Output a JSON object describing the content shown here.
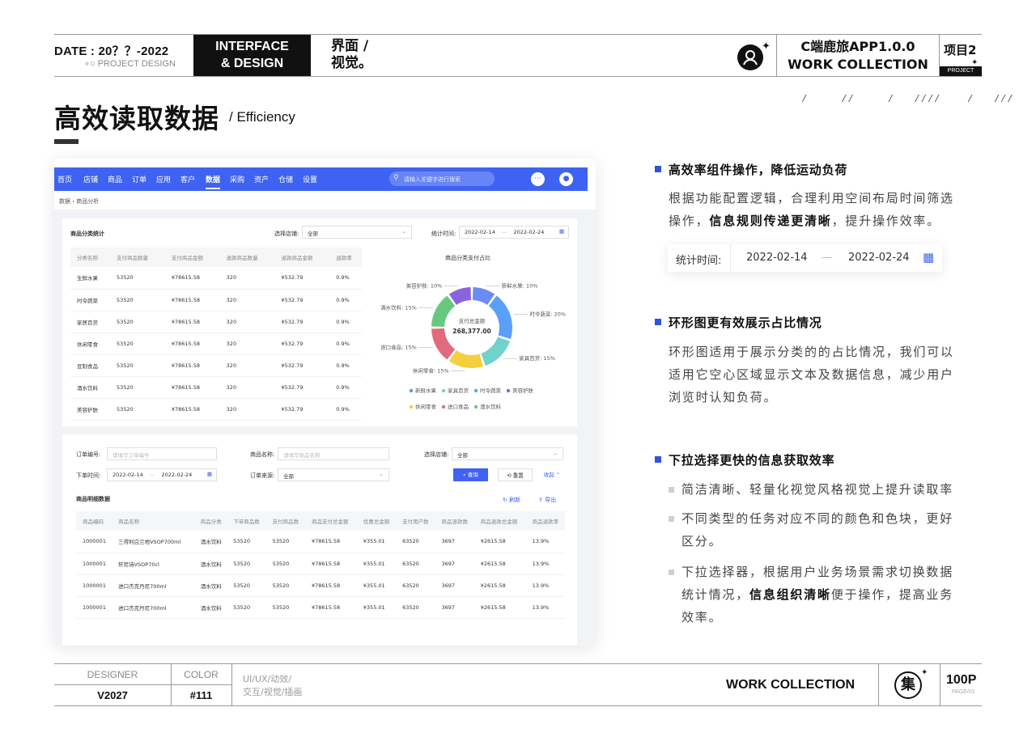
{
  "header": {
    "date": "DATE : 20？？-2022",
    "project_design": "∘○ PROJECT DESIGN",
    "interface_line1": "INTERFACE",
    "interface_line2": "& DESIGN",
    "cn_line1": "界面 /",
    "cn_line2": "视觉。",
    "app_title": "C端鹿旅APP1.0.0",
    "work_collection": "WORK  COLLECTION",
    "project_num": "项目2",
    "project_tag": "PROJECT"
  },
  "title": {
    "main": "高效读取数据",
    "english": "/ Efficiency",
    "slashes": "/     //     /   ////    /   ///"
  },
  "mockup": {
    "nav_items": [
      "首页",
      "店铺",
      "商品",
      "订单",
      "应用",
      "客户",
      "数据",
      "采购",
      "资产",
      "仓储",
      "设置"
    ],
    "active_nav": "数据",
    "search_placeholder": "请输入关键字进行搜索",
    "breadcrumb": "数据  ›  商品分析",
    "stats_panel": {
      "title": "商品分类统计",
      "store_label": "选择店铺:",
      "store_value": "全部",
      "time_label": "统计时间:",
      "date_start": "2022-02-14",
      "date_sep": "—",
      "date_end": "2022-02-24",
      "columns": [
        "分类名称",
        "支付商品数量",
        "支付商品金额",
        "退款商品数量",
        "退款商品金额",
        "退款率"
      ],
      "rows": [
        [
          "生鲜水果",
          "53520",
          "¥78615.58",
          "320",
          "¥532.79",
          "0.9%"
        ],
        [
          "时令蔬菜",
          "53520",
          "¥78615.58",
          "320",
          "¥532.79",
          "0.9%"
        ],
        [
          "家居百货",
          "53520",
          "¥78615.58",
          "320",
          "¥532.79",
          "0.9%"
        ],
        [
          "休闲零食",
          "53520",
          "¥78615.58",
          "320",
          "¥532.79",
          "0.9%"
        ],
        [
          "豆制食品",
          "53520",
          "¥78615.58",
          "320",
          "¥532.79",
          "0.9%"
        ],
        [
          "酒水饮料",
          "53520",
          "¥78615.58",
          "320",
          "¥532.79",
          "0.9%"
        ],
        [
          "美容护肤",
          "53520",
          "¥78615.58",
          "320",
          "¥532.79",
          "0.9%"
        ]
      ]
    },
    "chart_data": {
      "type": "pie",
      "title": "商品分类支付占比",
      "center_label": "支付总金额",
      "center_value": "268,377.00",
      "slices": [
        {
          "name": "新鲜水果",
          "value": 10,
          "label": "新鲜水果: 10%",
          "color": "#6b8cf6"
        },
        {
          "name": "时令蔬菜",
          "value": 20,
          "label": "时令蔬菜: 20%",
          "color": "#5aa0f8"
        },
        {
          "name": "家具百货",
          "value": 15,
          "label": "家具百货: 15%",
          "color": "#6fd2cc"
        },
        {
          "name": "休闲零食",
          "value": 15,
          "label": "休闲零食: 15%",
          "color": "#f6cf3d"
        },
        {
          "name": "进口食品",
          "value": 15,
          "label": "进口食品: 15%",
          "color": "#e26a7e"
        },
        {
          "name": "酒水饮料",
          "value": 15,
          "label": "酒水饮料: 15%",
          "color": "#67c981"
        },
        {
          "name": "美容护肤",
          "value": 10,
          "label": "美容护肤: 10%",
          "color": "#8a64e0"
        }
      ],
      "legend": [
        "新鲜水果",
        "家具百货",
        "时令蔬菜",
        "美容护肤",
        "休闲零食",
        "进口食品",
        "酒水饮料"
      ],
      "legend_colors": [
        "#6b8cf6",
        "#6fd2cc",
        "#5aa0f8",
        "#8a64e0",
        "#f6cf3d",
        "#e26a7e",
        "#67c981"
      ]
    },
    "filter_panel": {
      "order_no_label": "订单编号:",
      "order_no_placeholder": "请填写订单编号",
      "product_label": "商品名称:",
      "product_placeholder": "请填写商品名称",
      "store_label": "选择店铺:",
      "store_value": "全部",
      "order_time_label": "下单时间:",
      "date_start": "2022-02-14",
      "date_sep": "—",
      "date_end": "2022-02-24",
      "source_label": "订单来源:",
      "source_value": "全部",
      "query_btn": "查询",
      "reset_btn": "重置",
      "collapse_btn": "收起"
    },
    "detail_panel": {
      "title": "商品明细数据",
      "refresh": "刷新",
      "export": "导出",
      "columns": [
        "商品编码",
        "商品名称",
        "商品分类",
        "下单商品数",
        "支付商品数",
        "商品支付总金额",
        "优惠总金额",
        "支付用户数",
        "商品退款数",
        "商品退款总金额",
        "商品退款率"
      ],
      "rows": [
        [
          "1000001",
          "三得利白兰地VSOP700ml",
          "酒水饮料",
          "53520",
          "53520",
          "¥78615.58",
          "¥355.01",
          "63520",
          "3697",
          "¥2615.58",
          "13.9%"
        ],
        [
          "1000001",
          "轩尼诗VSOP70cl",
          "酒水饮料",
          "53520",
          "53520",
          "¥78615.58",
          "¥355.01",
          "63520",
          "3697",
          "¥2615.58",
          "13.9%"
        ],
        [
          "1000001",
          "进口杰克丹尼700ml",
          "酒水饮料",
          "53520",
          "53520",
          "¥78615.58",
          "¥355.01",
          "63520",
          "3697",
          "¥2615.58",
          "13.9%"
        ],
        [
          "1000001",
          "进口杰克丹尼700ml",
          "酒水饮料",
          "53520",
          "53520",
          "¥78615.58",
          "¥355.01",
          "63520",
          "3697",
          "¥2615.58",
          "13.9%"
        ]
      ]
    }
  },
  "right": {
    "s1_title": "高效率组件操作，降低运动负荷",
    "s1_line1": "根据功能配置逻辑，合理利用空间布局时间筛选",
    "s1_line2_a": "操作，",
    "s1_line2_b": "信息规则传递更清晰",
    "s1_line2_c": "，提升操作效率。",
    "demo_label": "统计时间:",
    "demo_start": "2022-02-14",
    "demo_sep": "—",
    "demo_end": "2022-02-24",
    "s2_title": "环形图更有效展示占比情况",
    "s2_line1": "环形图适用于展示分类的的占比情况，我们可以",
    "s2_line2": "适用它空心区域显示文本及数据信息，减少用户",
    "s2_line3": "浏览时认知负荷。",
    "s3_title": "下拉选择更快的信息获取效率",
    "b1": "简洁清晰、轻量化视觉风格视觉上提升读取率",
    "b2_line1": "不同类型的任务对应不同的颜色和色块，更好",
    "b2_line2": "区分。",
    "b3_line1": "下拉选择器，根据用户业务场景需求切换数据",
    "b3_line2_a": "统计情况，",
    "b3_line2_b": "信息组织清晰",
    "b3_line2_c": "便于操作，提高业务",
    "b3_line3": "效率。"
  },
  "footer": {
    "designer_label": "DESIGNER",
    "designer_value": "V2027",
    "color_label": "COLOR",
    "color_value": "#111",
    "tags_line1": "UI/UX/动效/",
    "tags_line2": "交互/视觉/插画",
    "work_collection": "WORK  COLLECTION",
    "logo_char": "集",
    "pages": "100P",
    "page_sub": "PAGE/01"
  }
}
